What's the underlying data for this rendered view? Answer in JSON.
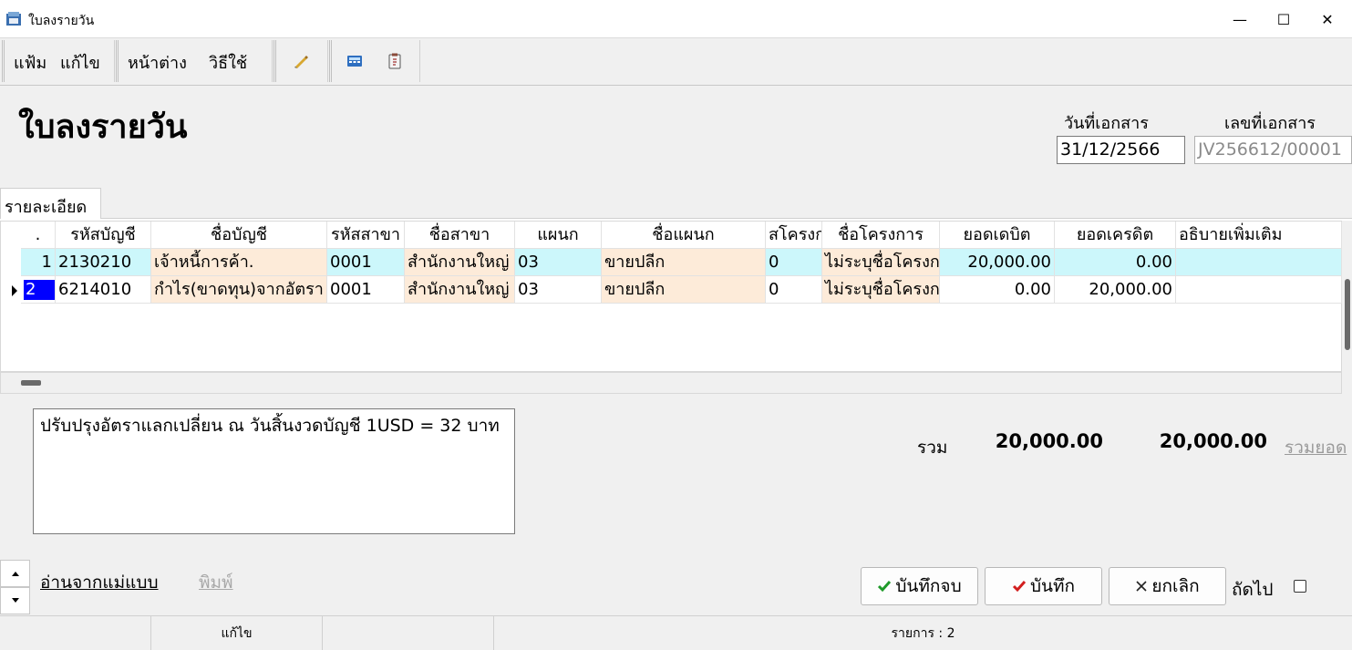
{
  "window": {
    "title": "ใบลงรายวัน",
    "minimize": "—",
    "maximize": "☐",
    "close": "✕"
  },
  "menu": {
    "file": "แฟ้ม",
    "edit": "แก้ไข",
    "window": "หน้าต่าง",
    "help": "วิธีใช้"
  },
  "toolbar": {
    "icons": [
      "pen-icon",
      "calculator-icon",
      "clipboard-icon"
    ]
  },
  "header": {
    "title": "ใบลงรายวัน",
    "doc_date_label": "วันที่เอกสาร",
    "doc_date_value": "31/12/2566",
    "doc_no_label": "เลขที่เอกสาร",
    "doc_no_value": "JV256612/00001"
  },
  "tab": {
    "label": "รายละเอียด"
  },
  "grid": {
    "headers": [
      ".",
      "รหัสบัญชี",
      "ชื่อบัญชี",
      "รหัสสาขา",
      "ชื่อสาขา",
      "แผนก",
      "ชื่อแผนก",
      "สโครงก",
      "ชื่อโครงการ",
      "ยอดเดบิต",
      "ยอดเครดิต",
      "อธิบายเพิ่มเติม"
    ],
    "rows": [
      [
        "1",
        "2130210",
        "เจ้าหนี้การค้า.",
        "0001",
        "สำนักงานใหญ่",
        "03",
        "ขายปลีก",
        "0",
        "ไม่ระบุชื่อโครงการ",
        "20,000.00",
        "0.00",
        ""
      ],
      [
        "2",
        "6214010",
        "กำไร(ขาดทุน)จากอัตรา",
        "0001",
        "สำนักงานใหญ่",
        "03",
        "ขายปลีก",
        "0",
        "ไม่ระบุชื่อโครงการ",
        "0.00",
        "20,000.00",
        ""
      ]
    ]
  },
  "memo": {
    "text": "ปรับปรุงอัตราแลกเปลี่ยน ณ วันสิ้นงวดบัญชี 1USD = 32 บาท"
  },
  "totals": {
    "label": "รวม",
    "debit": "20,000.00",
    "credit": "20,000.00",
    "sum_link": "รวมยอด"
  },
  "links": {
    "from_template": "อ่านจากแม่แบบ",
    "print": "พิมพ์"
  },
  "buttons": {
    "save_close": "บันทึกจบ",
    "save": "บันทึก",
    "cancel": "ยกเลิก",
    "next": "ถัดไป"
  },
  "status": {
    "mode": "แก้ไข",
    "items": "รายการ : 2"
  },
  "colors": {
    "row1": "#ccf7fb",
    "cyan_cell": "#cdf7fa",
    "peach_cell": "#fdebd9",
    "selected": "#0000ff"
  }
}
